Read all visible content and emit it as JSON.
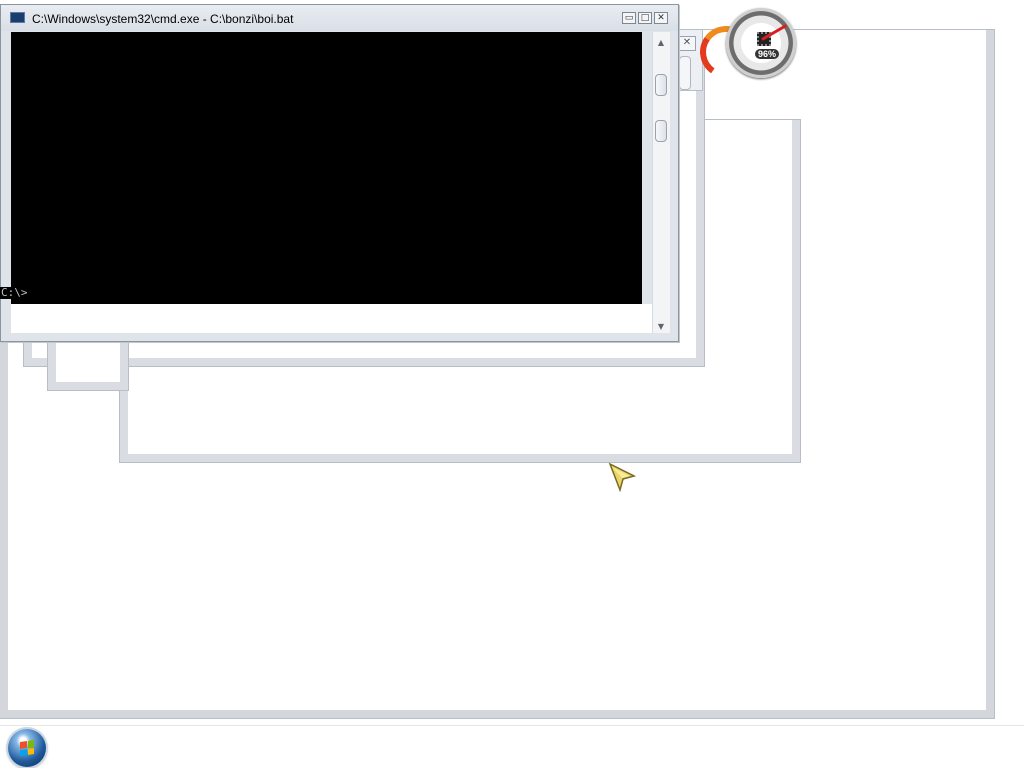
{
  "cmd_window": {
    "title": "C:\\Windows\\system32\\cmd.exe - C:\\bonzi\\boi.bat",
    "prompt": "C:\\>",
    "buttons": {
      "minimize": "▭",
      "maximize": "□",
      "close": "✕"
    }
  },
  "ghost_window": {
    "close": "✕"
  },
  "cpu_gadget": {
    "value": "96%"
  },
  "colors": {
    "console_bg": "#000000",
    "window_frame": "#dfe4ea",
    "gadget_orange": "#f08a1c",
    "gadget_red": "#e23b1d"
  },
  "icons": {
    "start": "windows-start-orb",
    "cursor": "arrow-pointer",
    "cmd": "console-window-icon"
  }
}
